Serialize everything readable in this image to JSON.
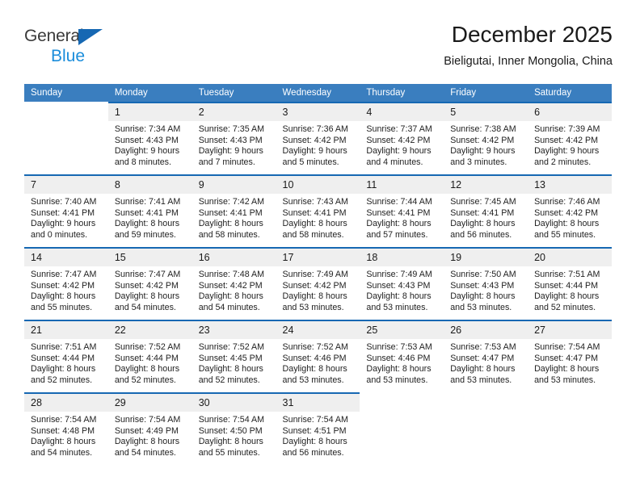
{
  "brand": {
    "line1": "General",
    "line2": "Blue",
    "triangle_color": "#1668b3",
    "blue_text_color": "#1b8ddb"
  },
  "header": {
    "title": "December 2025",
    "subtitle": "Bieligutai, Inner Mongolia, China"
  },
  "theme": {
    "header_bg": "#3a7ebf",
    "row_rule": "#1668b3",
    "daynum_bg": "#efefef"
  },
  "weekday_headers": [
    "Sunday",
    "Monday",
    "Tuesday",
    "Wednesday",
    "Thursday",
    "Friday",
    "Saturday"
  ],
  "weeks": [
    [
      {
        "day": "",
        "sunrise": "",
        "sunset": "",
        "daylight_line1": "",
        "daylight_line2": ""
      },
      {
        "day": "1",
        "sunrise": "Sunrise: 7:34 AM",
        "sunset": "Sunset: 4:43 PM",
        "daylight_line1": "Daylight: 9 hours",
        "daylight_line2": "and 8 minutes."
      },
      {
        "day": "2",
        "sunrise": "Sunrise: 7:35 AM",
        "sunset": "Sunset: 4:43 PM",
        "daylight_line1": "Daylight: 9 hours",
        "daylight_line2": "and 7 minutes."
      },
      {
        "day": "3",
        "sunrise": "Sunrise: 7:36 AM",
        "sunset": "Sunset: 4:42 PM",
        "daylight_line1": "Daylight: 9 hours",
        "daylight_line2": "and 5 minutes."
      },
      {
        "day": "4",
        "sunrise": "Sunrise: 7:37 AM",
        "sunset": "Sunset: 4:42 PM",
        "daylight_line1": "Daylight: 9 hours",
        "daylight_line2": "and 4 minutes."
      },
      {
        "day": "5",
        "sunrise": "Sunrise: 7:38 AM",
        "sunset": "Sunset: 4:42 PM",
        "daylight_line1": "Daylight: 9 hours",
        "daylight_line2": "and 3 minutes."
      },
      {
        "day": "6",
        "sunrise": "Sunrise: 7:39 AM",
        "sunset": "Sunset: 4:42 PM",
        "daylight_line1": "Daylight: 9 hours",
        "daylight_line2": "and 2 minutes."
      }
    ],
    [
      {
        "day": "7",
        "sunrise": "Sunrise: 7:40 AM",
        "sunset": "Sunset: 4:41 PM",
        "daylight_line1": "Daylight: 9 hours",
        "daylight_line2": "and 0 minutes."
      },
      {
        "day": "8",
        "sunrise": "Sunrise: 7:41 AM",
        "sunset": "Sunset: 4:41 PM",
        "daylight_line1": "Daylight: 8 hours",
        "daylight_line2": "and 59 minutes."
      },
      {
        "day": "9",
        "sunrise": "Sunrise: 7:42 AM",
        "sunset": "Sunset: 4:41 PM",
        "daylight_line1": "Daylight: 8 hours",
        "daylight_line2": "and 58 minutes."
      },
      {
        "day": "10",
        "sunrise": "Sunrise: 7:43 AM",
        "sunset": "Sunset: 4:41 PM",
        "daylight_line1": "Daylight: 8 hours",
        "daylight_line2": "and 58 minutes."
      },
      {
        "day": "11",
        "sunrise": "Sunrise: 7:44 AM",
        "sunset": "Sunset: 4:41 PM",
        "daylight_line1": "Daylight: 8 hours",
        "daylight_line2": "and 57 minutes."
      },
      {
        "day": "12",
        "sunrise": "Sunrise: 7:45 AM",
        "sunset": "Sunset: 4:41 PM",
        "daylight_line1": "Daylight: 8 hours",
        "daylight_line2": "and 56 minutes."
      },
      {
        "day": "13",
        "sunrise": "Sunrise: 7:46 AM",
        "sunset": "Sunset: 4:42 PM",
        "daylight_line1": "Daylight: 8 hours",
        "daylight_line2": "and 55 minutes."
      }
    ],
    [
      {
        "day": "14",
        "sunrise": "Sunrise: 7:47 AM",
        "sunset": "Sunset: 4:42 PM",
        "daylight_line1": "Daylight: 8 hours",
        "daylight_line2": "and 55 minutes."
      },
      {
        "day": "15",
        "sunrise": "Sunrise: 7:47 AM",
        "sunset": "Sunset: 4:42 PM",
        "daylight_line1": "Daylight: 8 hours",
        "daylight_line2": "and 54 minutes."
      },
      {
        "day": "16",
        "sunrise": "Sunrise: 7:48 AM",
        "sunset": "Sunset: 4:42 PM",
        "daylight_line1": "Daylight: 8 hours",
        "daylight_line2": "and 54 minutes."
      },
      {
        "day": "17",
        "sunrise": "Sunrise: 7:49 AM",
        "sunset": "Sunset: 4:42 PM",
        "daylight_line1": "Daylight: 8 hours",
        "daylight_line2": "and 53 minutes."
      },
      {
        "day": "18",
        "sunrise": "Sunrise: 7:49 AM",
        "sunset": "Sunset: 4:43 PM",
        "daylight_line1": "Daylight: 8 hours",
        "daylight_line2": "and 53 minutes."
      },
      {
        "day": "19",
        "sunrise": "Sunrise: 7:50 AM",
        "sunset": "Sunset: 4:43 PM",
        "daylight_line1": "Daylight: 8 hours",
        "daylight_line2": "and 53 minutes."
      },
      {
        "day": "20",
        "sunrise": "Sunrise: 7:51 AM",
        "sunset": "Sunset: 4:44 PM",
        "daylight_line1": "Daylight: 8 hours",
        "daylight_line2": "and 52 minutes."
      }
    ],
    [
      {
        "day": "21",
        "sunrise": "Sunrise: 7:51 AM",
        "sunset": "Sunset: 4:44 PM",
        "daylight_line1": "Daylight: 8 hours",
        "daylight_line2": "and 52 minutes."
      },
      {
        "day": "22",
        "sunrise": "Sunrise: 7:52 AM",
        "sunset": "Sunset: 4:44 PM",
        "daylight_line1": "Daylight: 8 hours",
        "daylight_line2": "and 52 minutes."
      },
      {
        "day": "23",
        "sunrise": "Sunrise: 7:52 AM",
        "sunset": "Sunset: 4:45 PM",
        "daylight_line1": "Daylight: 8 hours",
        "daylight_line2": "and 52 minutes."
      },
      {
        "day": "24",
        "sunrise": "Sunrise: 7:52 AM",
        "sunset": "Sunset: 4:46 PM",
        "daylight_line1": "Daylight: 8 hours",
        "daylight_line2": "and 53 minutes."
      },
      {
        "day": "25",
        "sunrise": "Sunrise: 7:53 AM",
        "sunset": "Sunset: 4:46 PM",
        "daylight_line1": "Daylight: 8 hours",
        "daylight_line2": "and 53 minutes."
      },
      {
        "day": "26",
        "sunrise": "Sunrise: 7:53 AM",
        "sunset": "Sunset: 4:47 PM",
        "daylight_line1": "Daylight: 8 hours",
        "daylight_line2": "and 53 minutes."
      },
      {
        "day": "27",
        "sunrise": "Sunrise: 7:54 AM",
        "sunset": "Sunset: 4:47 PM",
        "daylight_line1": "Daylight: 8 hours",
        "daylight_line2": "and 53 minutes."
      }
    ],
    [
      {
        "day": "28",
        "sunrise": "Sunrise: 7:54 AM",
        "sunset": "Sunset: 4:48 PM",
        "daylight_line1": "Daylight: 8 hours",
        "daylight_line2": "and 54 minutes."
      },
      {
        "day": "29",
        "sunrise": "Sunrise: 7:54 AM",
        "sunset": "Sunset: 4:49 PM",
        "daylight_line1": "Daylight: 8 hours",
        "daylight_line2": "and 54 minutes."
      },
      {
        "day": "30",
        "sunrise": "Sunrise: 7:54 AM",
        "sunset": "Sunset: 4:50 PM",
        "daylight_line1": "Daylight: 8 hours",
        "daylight_line2": "and 55 minutes."
      },
      {
        "day": "31",
        "sunrise": "Sunrise: 7:54 AM",
        "sunset": "Sunset: 4:51 PM",
        "daylight_line1": "Daylight: 8 hours",
        "daylight_line2": "and 56 minutes."
      },
      {
        "day": "",
        "sunrise": "",
        "sunset": "",
        "daylight_line1": "",
        "daylight_line2": ""
      },
      {
        "day": "",
        "sunrise": "",
        "sunset": "",
        "daylight_line1": "",
        "daylight_line2": ""
      },
      {
        "day": "",
        "sunrise": "",
        "sunset": "",
        "daylight_line1": "",
        "daylight_line2": ""
      }
    ]
  ]
}
